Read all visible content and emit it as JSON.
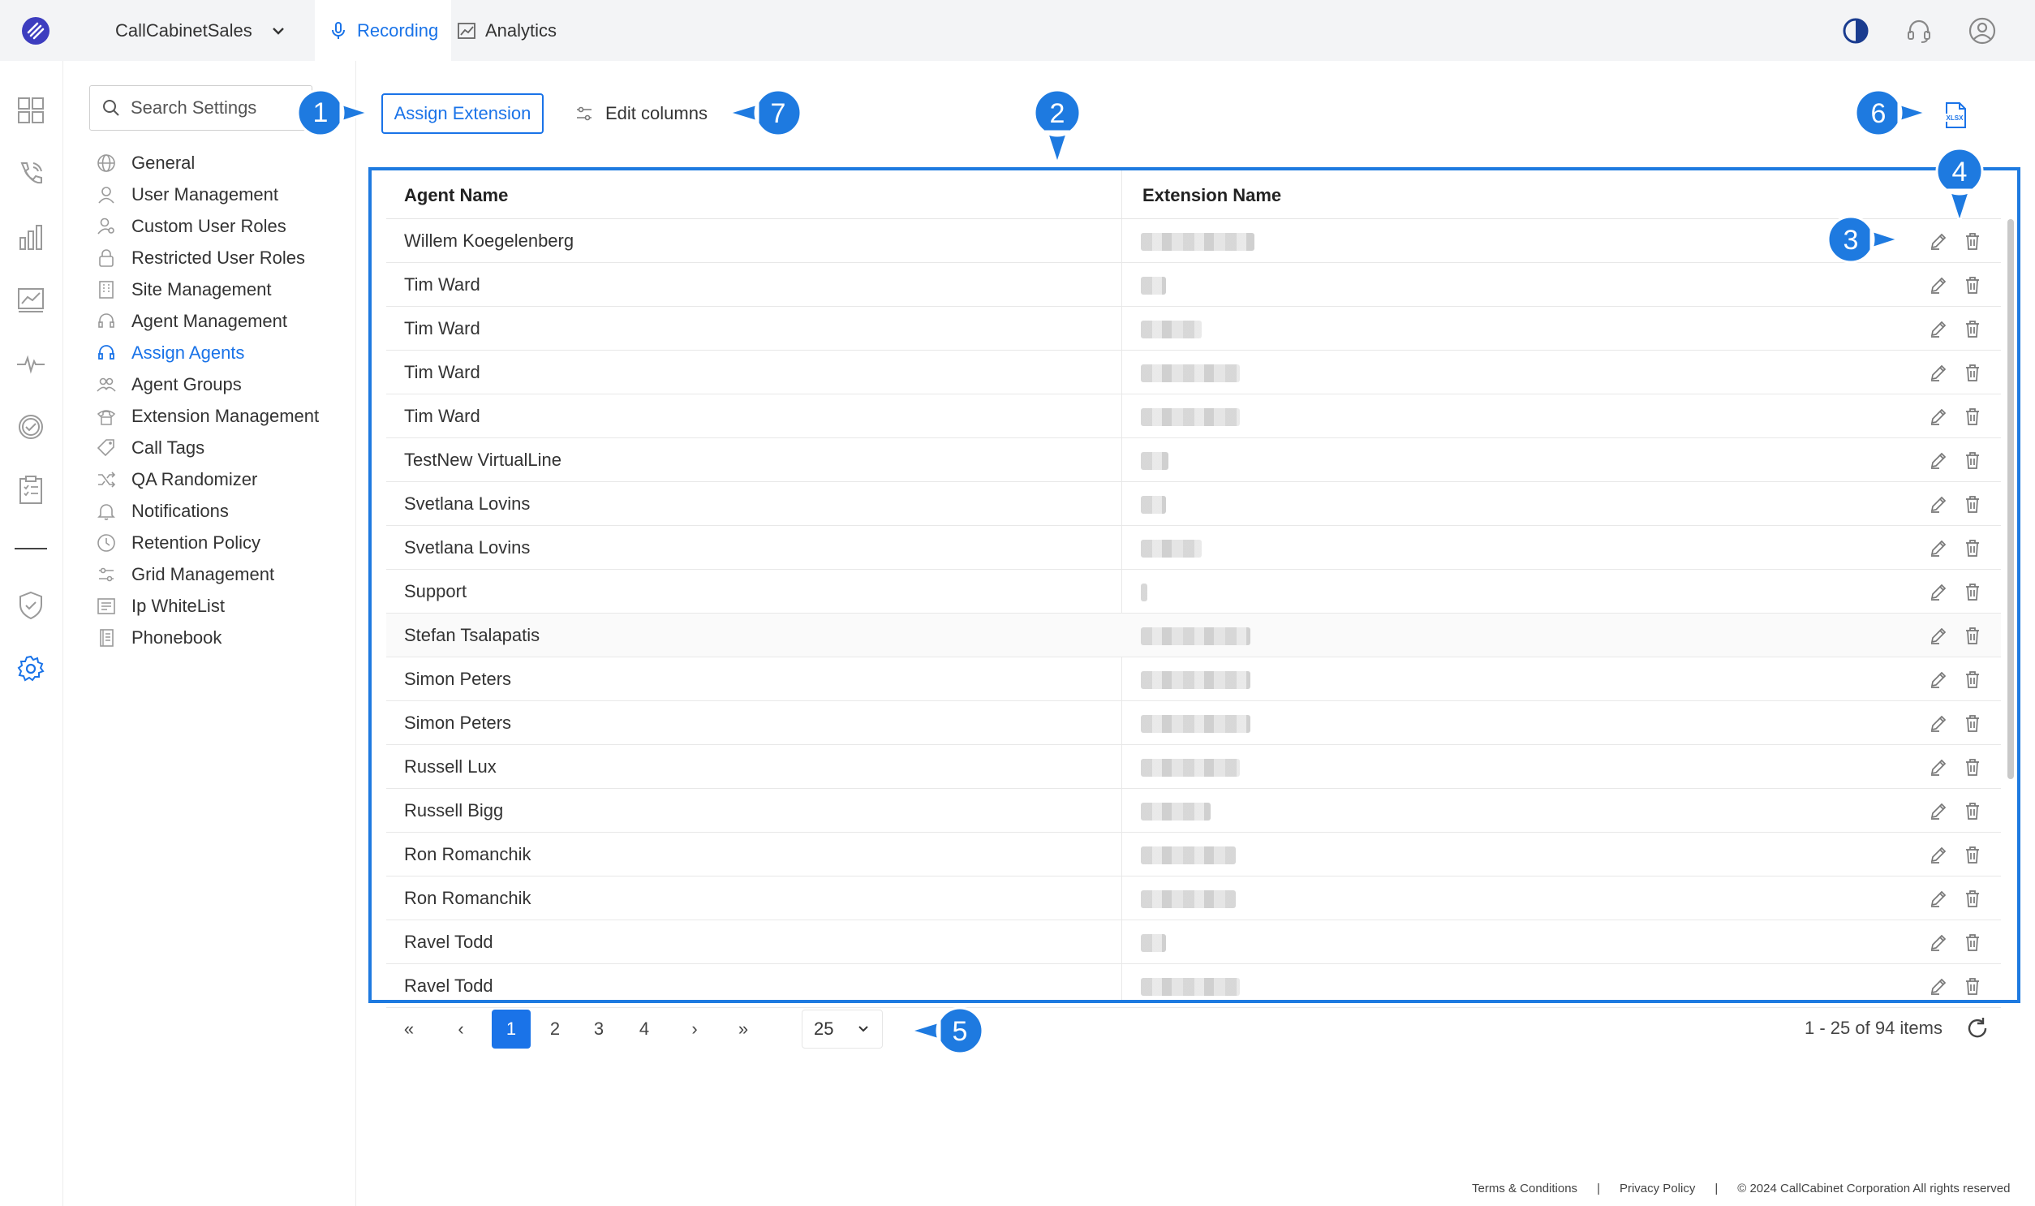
{
  "topbar": {
    "org_name": "CallCabinetSales",
    "tabs": [
      {
        "label": "Recording",
        "icon": "microphone-icon",
        "active": true
      },
      {
        "label": "Analytics",
        "icon": "analytics-chart-icon",
        "active": false
      }
    ],
    "right_icons": [
      "contrast-icon",
      "headset-support-icon",
      "user-profile-icon"
    ]
  },
  "rail": {
    "icons": [
      "dashboard-icon",
      "phone-calls-icon",
      "bar-chart-icon",
      "trend-chart-icon",
      "pulse-icon",
      "check-circle-icon",
      "clipboard-icon",
      "shield-check-icon",
      "settings-gear-icon"
    ],
    "active": "settings-gear-icon"
  },
  "sidebar": {
    "search_placeholder": "Search Settings",
    "items": [
      {
        "label": "General",
        "icon": "globe-icon"
      },
      {
        "label": "User Management",
        "icon": "user-icon"
      },
      {
        "label": "Custom User Roles",
        "icon": "user-key-icon"
      },
      {
        "label": "Restricted User Roles",
        "icon": "lock-icon"
      },
      {
        "label": "Site Management",
        "icon": "building-icon"
      },
      {
        "label": "Agent Management",
        "icon": "headset-icon"
      },
      {
        "label": "Assign Agents",
        "icon": "assign-headset-icon",
        "active": true
      },
      {
        "label": "Agent Groups",
        "icon": "users-group-icon"
      },
      {
        "label": "Extension Management",
        "icon": "extension-phone-icon"
      },
      {
        "label": "Call Tags",
        "icon": "tag-icon"
      },
      {
        "label": "QA Randomizer",
        "icon": "shuffle-icon"
      },
      {
        "label": "Notifications",
        "icon": "bell-icon"
      },
      {
        "label": "Retention Policy",
        "icon": "clock-icon"
      },
      {
        "label": "Grid Management",
        "icon": "sliders-icon"
      },
      {
        "label": "Ip WhiteList",
        "icon": "list-icon"
      },
      {
        "label": "Phonebook",
        "icon": "phonebook-icon"
      }
    ]
  },
  "toolbar": {
    "assign_label": "Assign Extension",
    "edit_columns_label": "Edit columns",
    "export_icon": "xlsx-export-icon"
  },
  "table": {
    "columns": [
      "Agent Name",
      "Extension Name"
    ],
    "rows": [
      {
        "agent": "Willem Koegelenberg",
        "ext_blur": 0.54
      },
      {
        "agent": "Tim Ward",
        "ext_blur": 0.12
      },
      {
        "agent": "Tim Ward",
        "ext_blur": 0.29
      },
      {
        "agent": "Tim Ward",
        "ext_blur": 0.47
      },
      {
        "agent": "Tim Ward",
        "ext_blur": 0.47
      },
      {
        "agent": "TestNew VirtualLine",
        "ext_blur": 0.13
      },
      {
        "agent": "Svetlana Lovins",
        "ext_blur": 0.12
      },
      {
        "agent": "Svetlana Lovins",
        "ext_blur": 0.29
      },
      {
        "agent": "Support",
        "ext_blur": 0.03
      },
      {
        "agent": "Stefan Tsalapatis",
        "ext_blur": 0.52
      },
      {
        "agent": "Simon Peters",
        "ext_blur": 0.52
      },
      {
        "agent": "Simon Peters",
        "ext_blur": 0.52
      },
      {
        "agent": "Russell Lux",
        "ext_blur": 0.47
      },
      {
        "agent": "Russell Bigg",
        "ext_blur": 0.33
      },
      {
        "agent": "Ron Romanchik",
        "ext_blur": 0.45
      },
      {
        "agent": "Ron Romanchik",
        "ext_blur": 0.45
      },
      {
        "agent": "Ravel Todd",
        "ext_blur": 0.12
      },
      {
        "agent": "Ravel Todd",
        "ext_blur": 0.47
      }
    ]
  },
  "pagination": {
    "pages": [
      "1",
      "2",
      "3",
      "4"
    ],
    "current": "1",
    "page_size": "25",
    "items_text": "1 - 25 of 94 items"
  },
  "callouts": [
    "1",
    "2",
    "3",
    "4",
    "5",
    "6",
    "7"
  ],
  "footer": {
    "terms": "Terms & Conditions",
    "privacy": "Privacy Policy",
    "copyright": "© 2024 CallCabinet Corporation All rights reserved",
    "separator": "|"
  },
  "colors": {
    "accent": "#1a73e8",
    "callout": "#1e7ae0",
    "topbar_bg": "#f3f4f6"
  }
}
